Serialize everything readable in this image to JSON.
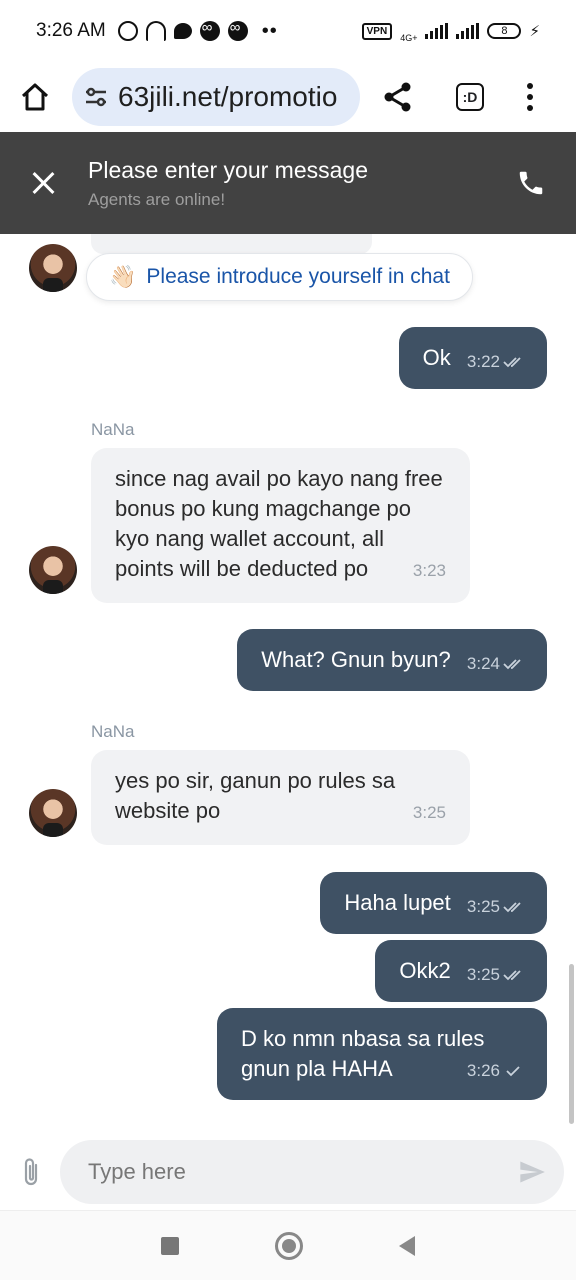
{
  "status_bar": {
    "time": "3:26 AM",
    "vpn": "VPN",
    "network": "4G+",
    "battery": "8",
    "more": "••"
  },
  "browser": {
    "url": "63jili.net/promotio",
    "icons": [
      "home-icon",
      "tune-icon",
      "share-icon",
      "tab-switcher-icon",
      "more-vert-icon"
    ],
    "tab_label": ":D"
  },
  "chat_header": {
    "title": "Please enter your message",
    "subtitle": "Agents are online!"
  },
  "intro_pill": {
    "emoji": "👋🏻",
    "text": "Please introduce yourself in chat"
  },
  "messages": [
    {
      "from": "user",
      "text": "Ok",
      "time": "3:22",
      "status": "read"
    },
    {
      "from": "agent",
      "sender": "NaNa",
      "text": "since nag avail po kayo nang free bonus po kung magchange po kyo nang wallet account, all points will be deducted po",
      "time": "3:23"
    },
    {
      "from": "user",
      "text": "What? Gnun byun?",
      "time": "3:24",
      "status": "read"
    },
    {
      "from": "agent",
      "sender": "NaNa",
      "text": "yes po sir, ganun po rules sa website po",
      "time": "3:25"
    },
    {
      "from": "user",
      "text": "Haha lupet",
      "time": "3:25",
      "status": "read"
    },
    {
      "from": "user",
      "text": "Okk2",
      "time": "3:25",
      "status": "read"
    },
    {
      "from": "user",
      "text": "D ko nmn nbasa sa rules gnun pla HAHA",
      "time": "3:26",
      "status": "sent"
    }
  ],
  "input": {
    "placeholder": "Type here",
    "value": ""
  },
  "colors": {
    "header_bg": "#424242",
    "user_bubble": "#3f5164",
    "agent_bubble": "#f1f2f4",
    "url_pill": "#e3ebf9",
    "link_blue": "#1a55a8"
  }
}
